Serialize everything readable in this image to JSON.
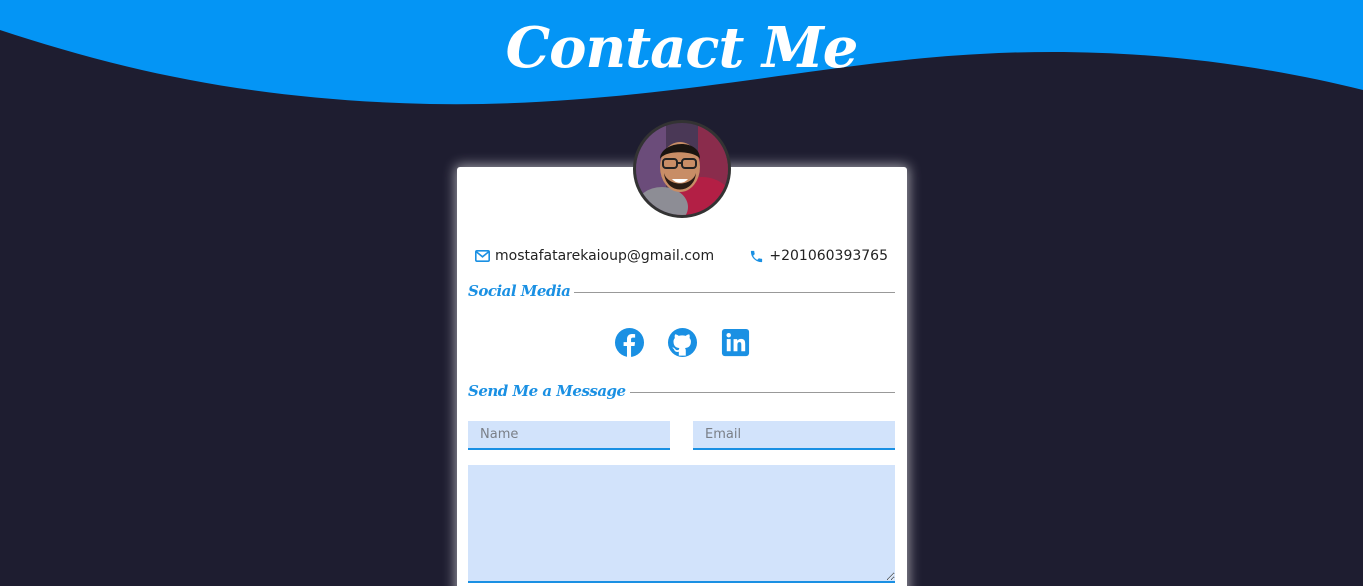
{
  "header": {
    "title": "Contact Me",
    "wave_color": "#0495f5",
    "background_color": "#1e1d30"
  },
  "profile": {
    "avatar_icon": "profile-photo"
  },
  "contact": {
    "email": "mostafatarekaioup@gmail.com",
    "email_icon": "envelope-icon",
    "phone": "+201060393765",
    "phone_icon": "phone-icon",
    "accent_color": "#1a90e3"
  },
  "social": {
    "heading": "Social Media",
    "links": [
      {
        "icon": "facebook-icon"
      },
      {
        "icon": "github-icon"
      },
      {
        "icon": "linkedin-icon"
      }
    ]
  },
  "message_form": {
    "heading": "Send Me a Message",
    "name_placeholder": "Name",
    "email_placeholder": "Email",
    "message_placeholder": ""
  }
}
